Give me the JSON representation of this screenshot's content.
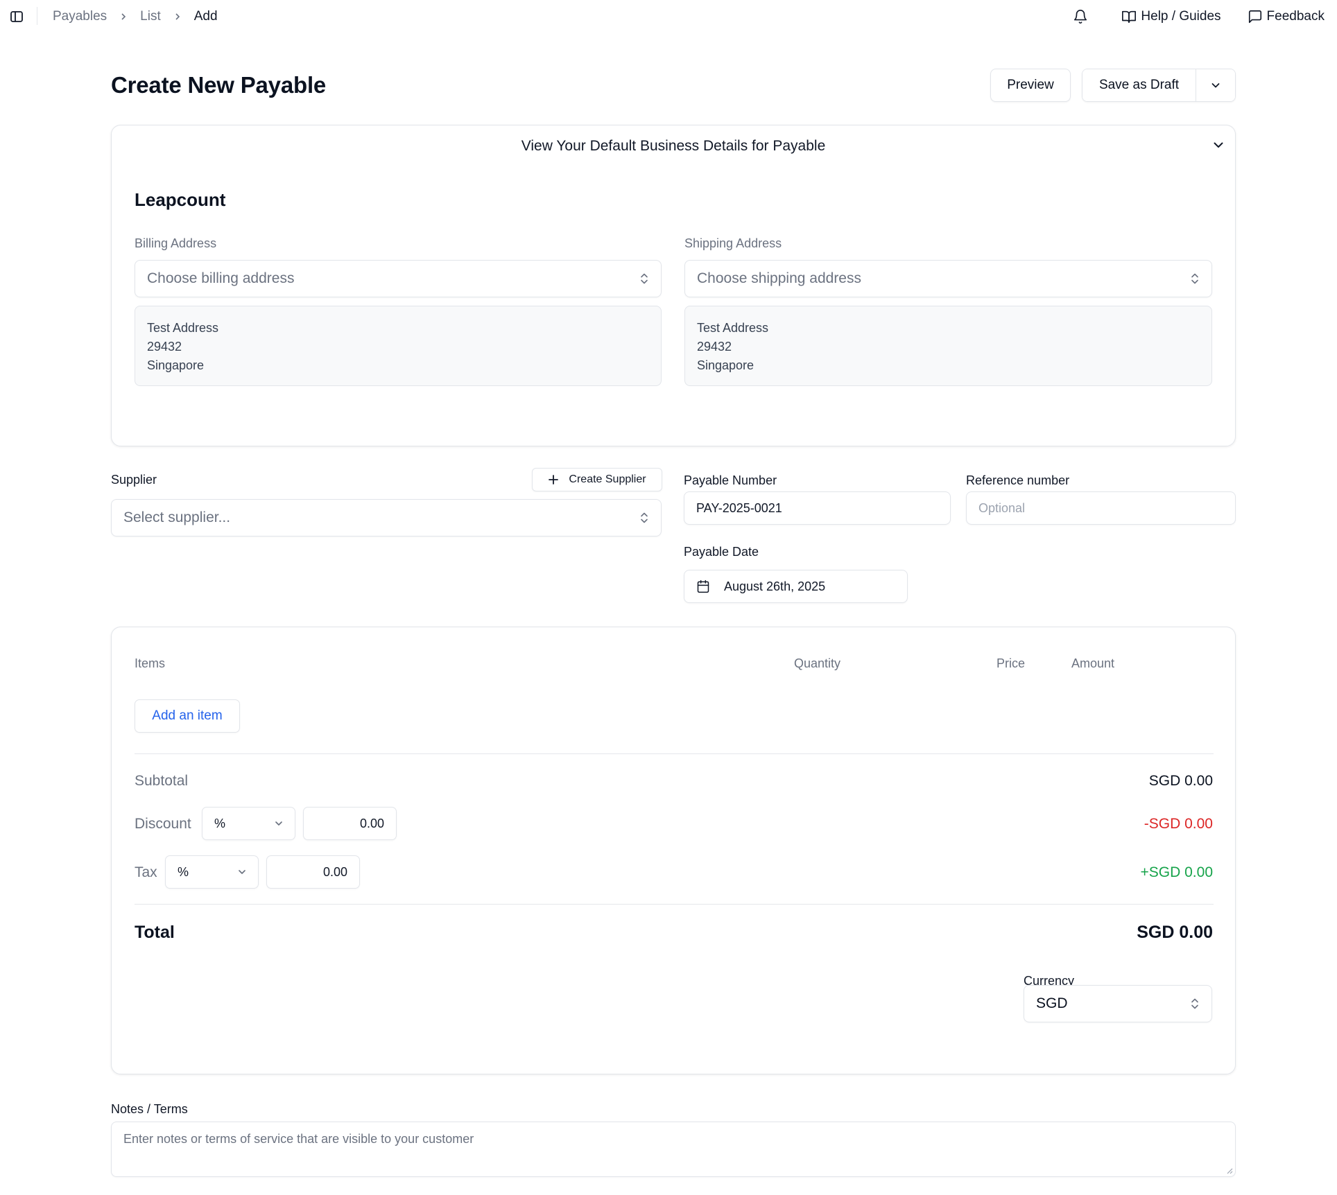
{
  "topbar": {
    "breadcrumb": [
      "Payables",
      "List",
      "Add"
    ],
    "help_label": "Help / Guides",
    "feedback_label": "Feedback"
  },
  "header": {
    "title": "Create New Payable",
    "preview_label": "Preview",
    "save_draft_label": "Save as Draft"
  },
  "business": {
    "toggle_label": "View Your Default Business Details for Payable",
    "name": "Leapcount",
    "billing": {
      "label": "Billing Address",
      "placeholder": "Choose billing address",
      "lines": [
        "Test Address",
        "29432",
        "Singapore"
      ]
    },
    "shipping": {
      "label": "Shipping Address",
      "placeholder": "Choose shipping address",
      "lines": [
        "Test Address",
        "29432",
        "Singapore"
      ]
    }
  },
  "form": {
    "supplier_label": "Supplier",
    "create_supplier_label": "Create Supplier",
    "supplier_placeholder": "Select supplier...",
    "payable_number_label": "Payable Number",
    "payable_number_value": "PAY-2025-0021",
    "reference_label": "Reference number",
    "reference_placeholder": "Optional",
    "payable_date_label": "Payable Date",
    "payable_date_value": "August 26th, 2025"
  },
  "items": {
    "columns": [
      "Items",
      "Quantity",
      "Price",
      "Amount"
    ],
    "add_item_label": "Add an item",
    "subtotal_label": "Subtotal",
    "subtotal_value": "SGD 0.00",
    "discount_label": "Discount",
    "discount_type": "%",
    "discount_amount": "0.00",
    "discount_value": "-SGD 0.00",
    "tax_label": "Tax",
    "tax_type": "%",
    "tax_amount": "0.00",
    "tax_value": "+SGD 0.00",
    "total_label": "Total",
    "total_value": "SGD 0.00",
    "currency_label": "Currency",
    "currency_value": "SGD"
  },
  "notes": {
    "label": "Notes / Terms",
    "placeholder": "Enter notes or terms of service that are visible to your customer"
  },
  "colors": {
    "accent_link": "#2563eb",
    "negative": "#dc2626",
    "positive": "#16a34a"
  }
}
